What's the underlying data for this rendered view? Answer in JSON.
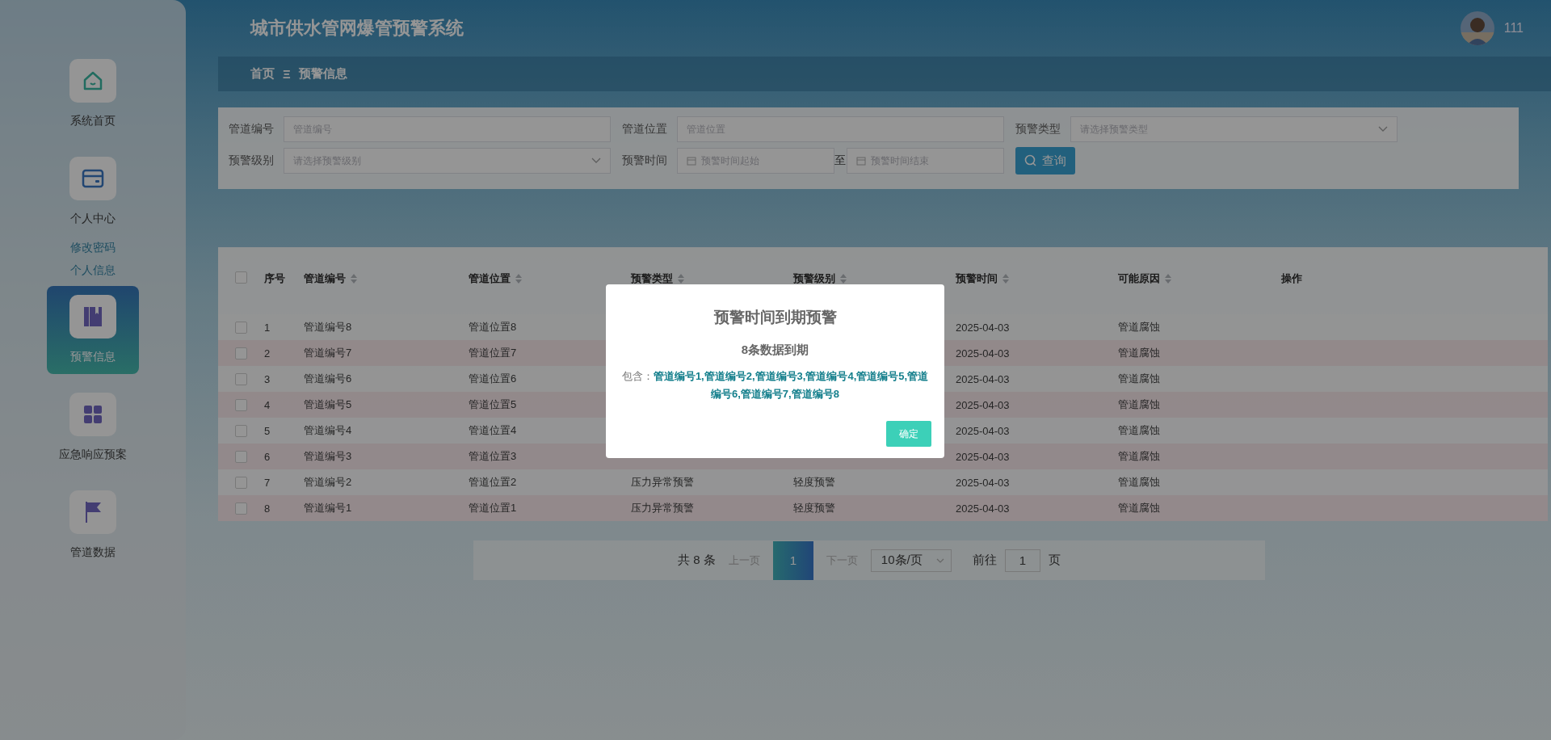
{
  "app": {
    "title": "城市供水管网爆管预警系统",
    "user": {
      "name": "111"
    }
  },
  "sidebar": {
    "items": [
      {
        "label": "系统首页",
        "kind": "home",
        "selected": false
      },
      {
        "label": "个人中心",
        "kind": "card",
        "selected": false,
        "children": [
          {
            "label": "修改密码"
          },
          {
            "label": "个人信息"
          }
        ]
      },
      {
        "label": "预警信息",
        "kind": "book",
        "selected": true
      },
      {
        "label": "应急响应预案",
        "kind": "grid",
        "selected": false
      },
      {
        "label": "管道数据",
        "kind": "flag",
        "selected": false
      }
    ]
  },
  "breadcrumb": {
    "items": [
      "首页",
      "预警信息"
    ],
    "separator": "Ξ"
  },
  "filters": [
    {
      "label": "管道编号",
      "kind": "input",
      "placeholder": "管道编号"
    },
    {
      "label": "管道位置",
      "kind": "input",
      "placeholder": "管道位置"
    },
    {
      "label": "预警类型",
      "kind": "select",
      "placeholder": "请选择预警类型"
    },
    {
      "label": "预警级别",
      "kind": "select",
      "placeholder": "请选择预警级别"
    },
    {
      "label": "预警时间",
      "kind": "daterange",
      "placeholder": "预警时间起始",
      "separator": "至",
      "placeholder_end": "预警时间结束"
    }
  ],
  "search_button": "查询",
  "table": {
    "header_checked": false,
    "columns": [
      {
        "label": "序号",
        "sortable": false
      },
      {
        "label": "管道编号",
        "sortable": true
      },
      {
        "label": "管道位置",
        "sortable": true
      },
      {
        "label": "预警类型",
        "sortable": true
      },
      {
        "label": "预警级别",
        "sortable": true
      },
      {
        "label": "预警时间",
        "sortable": true
      },
      {
        "label": "可能原因",
        "sortable": true
      },
      {
        "label": "操作",
        "sortable": false
      }
    ],
    "rows": [
      {
        "checked": false,
        "index": "1",
        "pipe_no": "管道编号8",
        "location": "管道位置8",
        "time": "2025-04-03",
        "reason": "管道腐蚀"
      },
      {
        "checked": false,
        "index": "2",
        "pipe_no": "管道编号7",
        "location": "管道位置7",
        "time": "2025-04-03",
        "reason": "管道腐蚀"
      },
      {
        "checked": false,
        "index": "3",
        "pipe_no": "管道编号6",
        "location": "管道位置6",
        "time": "2025-04-03",
        "reason": "管道腐蚀"
      },
      {
        "checked": false,
        "index": "4",
        "pipe_no": "管道编号5",
        "location": "管道位置5",
        "time": "2025-04-03",
        "reason": "管道腐蚀"
      },
      {
        "checked": false,
        "index": "5",
        "pipe_no": "管道编号4",
        "location": "管道位置4",
        "time": "2025-04-03",
        "reason": "管道腐蚀"
      },
      {
        "checked": false,
        "index": "6",
        "pipe_no": "管道编号3",
        "location": "管道位置3",
        "time": "2025-04-03",
        "reason": "管道腐蚀"
      },
      {
        "checked": false,
        "index": "7",
        "pipe_no": "管道编号2",
        "location": "管道位置2",
        "type": "压力异常预警",
        "level": "轻度预警",
        "time": "2025-04-03",
        "reason": "管道腐蚀"
      },
      {
        "checked": false,
        "index": "8",
        "pipe_no": "管道编号1",
        "location": "管道位置1",
        "type": "压力异常预警",
        "level": "轻度预警",
        "time": "2025-04-03",
        "reason": "管道腐蚀"
      }
    ]
  },
  "pagination": {
    "total": "共 8 条",
    "prev": {
      "label": "上一页",
      "disabled": true
    },
    "pages": [
      {
        "label": "1",
        "selected": true
      }
    ],
    "next": {
      "label": "下一页",
      "disabled": true
    },
    "page_size": "10条/页",
    "goto_label": "前往",
    "goto_value": "1",
    "goto_suffix": "页"
  },
  "dialog": {
    "title": "预警时间到期预警",
    "subtitle": "8条数据到期",
    "contains_label": "包含：",
    "contains_text": "管道编号1,管道编号2,管道编号3,管道编号4,管道编号5,管道编号6,管道编号7,管道编号8",
    "button": "确定"
  }
}
